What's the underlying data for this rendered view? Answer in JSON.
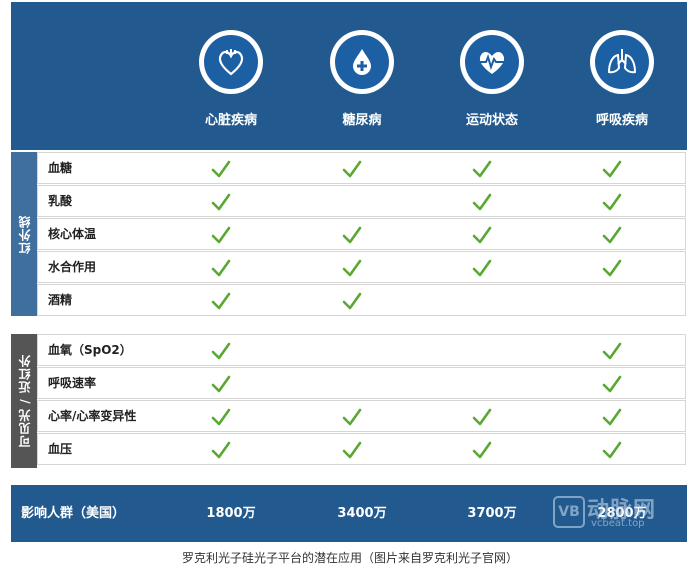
{
  "columns": [
    {
      "label": "心脏疾病",
      "icon": "heart-icon"
    },
    {
      "label": "糖尿病",
      "icon": "blood-drop-plus-icon"
    },
    {
      "label": "运动状态",
      "icon": "heartbeat-pulse-icon"
    },
    {
      "label": "呼吸疾病",
      "icon": "lungs-icon"
    }
  ],
  "groups": [
    {
      "label": "红外线",
      "rows": [
        {
          "label": "血糖",
          "checks": [
            true,
            true,
            true,
            true
          ]
        },
        {
          "label": "乳酸",
          "checks": [
            true,
            false,
            true,
            true
          ]
        },
        {
          "label": "核心体温",
          "checks": [
            true,
            true,
            true,
            true
          ]
        },
        {
          "label": "水合作用",
          "checks": [
            true,
            true,
            true,
            true
          ]
        },
        {
          "label": "酒精",
          "checks": [
            true,
            true,
            false,
            false
          ]
        }
      ]
    },
    {
      "label": "可见光 / 近红外",
      "rows": [
        {
          "label": "血氧（SpO2）",
          "checks": [
            true,
            false,
            false,
            true
          ]
        },
        {
          "label": "呼吸速率",
          "checks": [
            true,
            false,
            false,
            true
          ]
        },
        {
          "label": "心率/心率变异性",
          "checks": [
            true,
            true,
            true,
            true
          ]
        },
        {
          "label": "血压",
          "checks": [
            true,
            true,
            true,
            true
          ]
        }
      ]
    }
  ],
  "footer": {
    "label": "影响人群（美国）",
    "values": [
      "1800万",
      "3400万",
      "3700万",
      "2800万"
    ]
  },
  "caption": "罗克利光子硅光子平台的潜在应用（图片来自罗克利光子官网）",
  "watermark": {
    "text": "动脉网",
    "sub": "vcbeat.top",
    "badge": "VB"
  },
  "colors": {
    "header": "#225a8f",
    "check": "#5aa832",
    "ir_band": "#3f6f9f",
    "vis_band": "#555555"
  }
}
